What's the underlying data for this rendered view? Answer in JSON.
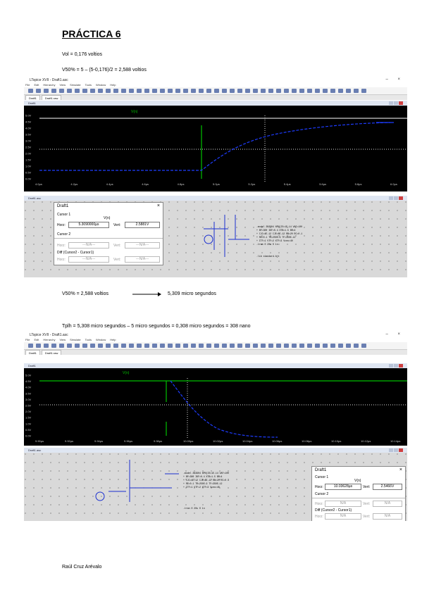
{
  "doc": {
    "title": "PRÁCTICA 6",
    "line_vol": "Vol = 0,176 voltios",
    "line_v50": "V50% = 5 – (5-0,176)/2 = 2,588 voltios",
    "line_v50_arrow_left": "V50% = 2,588 voltios",
    "line_v50_arrow_right": "5,309 micro segundos",
    "line_tplh": "Tplh = 5,308 micro segundos – 5 micro segundos = 0,308 micro segundos = 308 nano",
    "signature": "Raúl Cruz Arévalo"
  },
  "shot1": {
    "window_title": "LTspice XVII - Draft1.asc",
    "menu": [
      "File",
      "Edit",
      "Hierarchy",
      "View",
      "Simulate",
      "Tools",
      "Window",
      "Help"
    ],
    "tabs": [
      "Draft1",
      "Draft1.raw"
    ],
    "plot_title": "Draft1",
    "trace_label": "V(n)",
    "y_ticks": [
      "5.0V",
      "4.5V",
      "4.0V",
      "3.5V",
      "3.0V",
      "2.5V",
      "2.0V",
      "1.5V",
      "1.0V",
      "0.5V",
      "0.0V"
    ],
    "x_ticks": [
      "4.0µs",
      "4.2µs",
      "4.4µs",
      "4.6µs",
      "4.8µs",
      "5.0µs",
      "5.2µs",
      "5.4µs",
      "5.6µs",
      "5.8µs",
      "6.0µs"
    ],
    "schem_title": "Draft1.asc",
    "dialog": {
      "title": "Draft1",
      "cursor1_label": "Cursor 1",
      "trace_name": "V(n)",
      "horz_label": "Horz:",
      "horz_value": "5.3090000µs",
      "vert_label": "Vert:",
      "vert_value": "2.5881V",
      "cursor2_label": "Cursor 2",
      "na": "---N/A---",
      "diff_label": "Diff (Cursor2 - Cursor1)"
    }
  },
  "shot2": {
    "window_title": "LTspice XVII - Draft1.asc",
    "menu": [
      "File",
      "Edit",
      "Hierarchy",
      "View",
      "Simulate",
      "Tools",
      "Window",
      "Help"
    ],
    "tabs": [
      "Draft1",
      "Draft1.raw"
    ],
    "plot_title": "Draft1",
    "trace_label": "V(n)",
    "y_ticks": [
      "5.0V",
      "4.5V",
      "4.0V",
      "3.5V",
      "3.0V",
      "2.5V",
      "2.0V",
      "1.5V",
      "1.0V",
      "0.5V",
      "0.0V"
    ],
    "x_ticks": [
      "9.90µs",
      "9.92µs",
      "9.94µs",
      "9.96µs",
      "9.98µs",
      "10.00µs",
      "10.02µs",
      "10.04µs",
      "10.06µs",
      "10.08µs",
      "10.10µs",
      "10.12µs",
      "10.14µs"
    ],
    "schem_title": "Draft1.asc",
    "dialog": {
      "title": "Draft1",
      "cursor1_label": "Cursor 1",
      "trace_name": "V(n)",
      "horz_label": "Horz:",
      "horz_value": "10.03628µs",
      "vert_label": "Vert:",
      "vert_value": "2.5466V",
      "cursor2_label": "Cursor 2",
      "na": "N/A",
      "diff_label": "Diff (Cursor2 - Cursor1)"
    }
  },
  "colors": {
    "trace": "#1e3cff",
    "vertical": "#00c000",
    "plot_bg": "#000000",
    "schem_bg": "#d9d9d9"
  }
}
